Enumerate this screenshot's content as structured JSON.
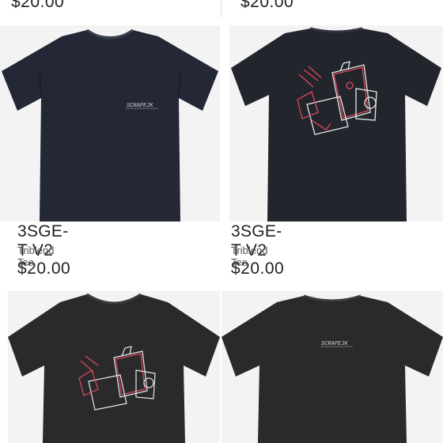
{
  "previous_row": {
    "left_price": "$20.00",
    "right_price": "$20.00"
  },
  "products": [
    {
      "title": "3SGE-T V2",
      "subtitle": "Triblend Tee",
      "price": "$20.00",
      "shirt_color": "#232736",
      "design": "front-small-logo"
    },
    {
      "title": "3SGE-T V2",
      "subtitle": "Triblend Tee",
      "price": "$20.00",
      "shirt_color": "#22252c",
      "design": "back-engine"
    },
    {
      "title": "",
      "subtitle": "",
      "price": "",
      "shirt_color": "#2a2a2c",
      "design": "front-engine"
    },
    {
      "title": "",
      "subtitle": "",
      "price": "",
      "shirt_color": "#2a2a2c",
      "design": "back-small-logo"
    }
  ],
  "colors": {
    "background": "#ffffff",
    "image_bg": "#f3f3f3",
    "text": "#222222",
    "subtext": "#555555",
    "engine_outline_red": "#e0485c",
    "engine_outline_white": "#e8e8e8"
  }
}
